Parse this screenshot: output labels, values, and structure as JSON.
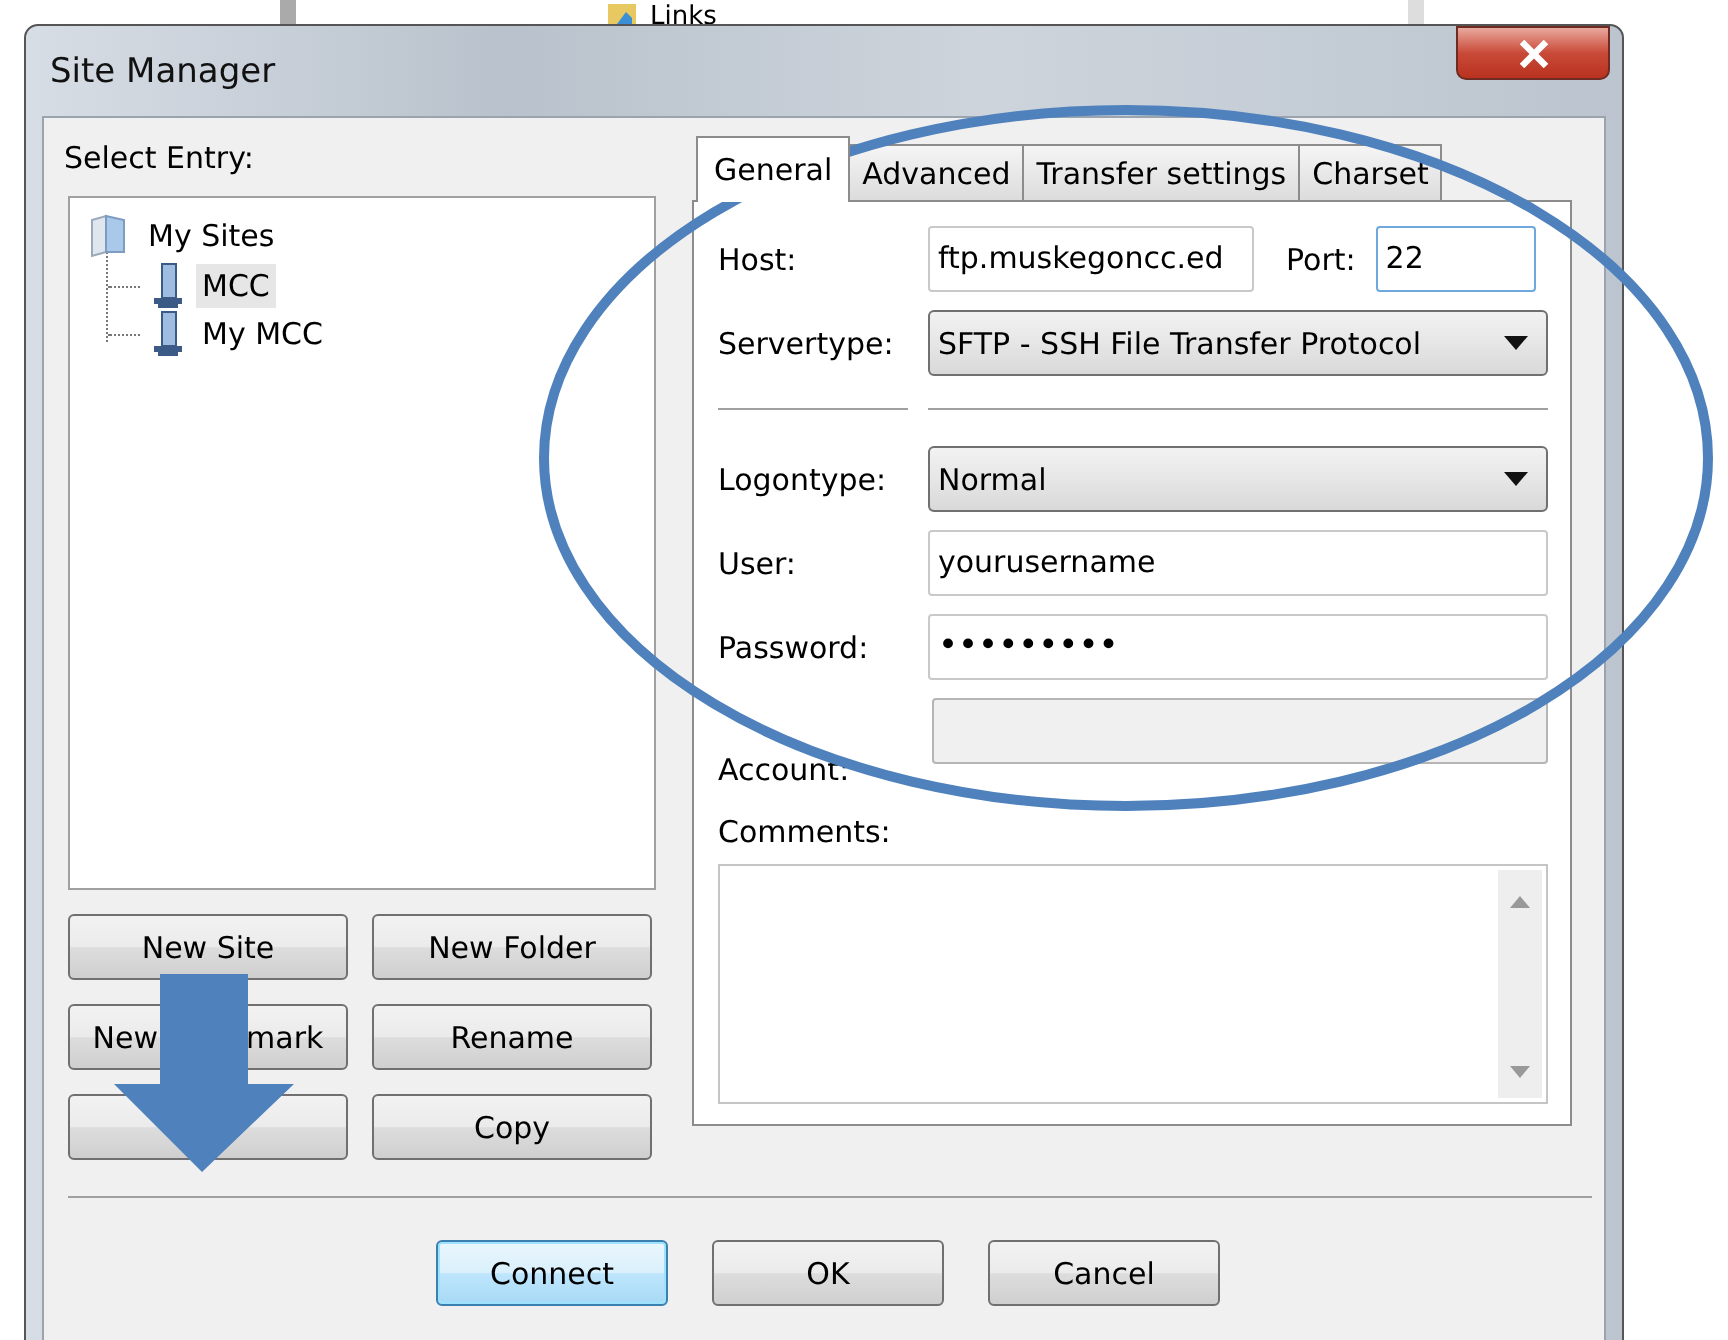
{
  "background_window": {
    "item": "Links"
  },
  "window": {
    "title": "Site Manager"
  },
  "select_entry_label": "Select Entry:",
  "tree": [
    {
      "label": "My Sites",
      "kind": "folder",
      "selected": false,
      "children": [
        {
          "label": "MCC",
          "kind": "server",
          "selected": true
        },
        {
          "label": "My MCC",
          "kind": "server",
          "selected": false
        }
      ]
    }
  ],
  "entry_buttons": [
    {
      "kind": "text",
      "label": "New Site"
    },
    {
      "kind": "text",
      "label": "New Folder"
    },
    {
      "kind": "split",
      "parts": [
        "New",
        "mark"
      ]
    },
    {
      "kind": "text",
      "label": "Rename"
    },
    {
      "kind": "hidden"
    },
    {
      "kind": "text",
      "label": "Copy"
    }
  ],
  "tabs": [
    {
      "label": "General",
      "selected": true
    },
    {
      "label": "Advanced",
      "selected": false
    },
    {
      "label": "Transfer settings",
      "selected": false
    },
    {
      "label": "Charset",
      "selected": false
    }
  ],
  "general": {
    "host": {
      "label": "Host:",
      "value": "ftp.muskegoncc.ed"
    },
    "port": {
      "label": "Port:",
      "value": "22",
      "focused": true
    },
    "servertype": {
      "label": "Servertype:",
      "value": "SFTP - SSH File Transfer Protocol"
    },
    "logontype": {
      "label": "Logontype:",
      "value": "Normal"
    },
    "user": {
      "label": "User:",
      "value": "yourusername"
    },
    "password": {
      "label": "Password:",
      "value": "•••••••••"
    },
    "account": {
      "label": "Account:",
      "disabled": true
    },
    "comments": {
      "label": "Comments:"
    }
  },
  "dialog_buttons": [
    {
      "label": "Connect",
      "default": true
    },
    {
      "label": "OK",
      "default": false
    },
    {
      "label": "Cancel",
      "default": false
    }
  ]
}
